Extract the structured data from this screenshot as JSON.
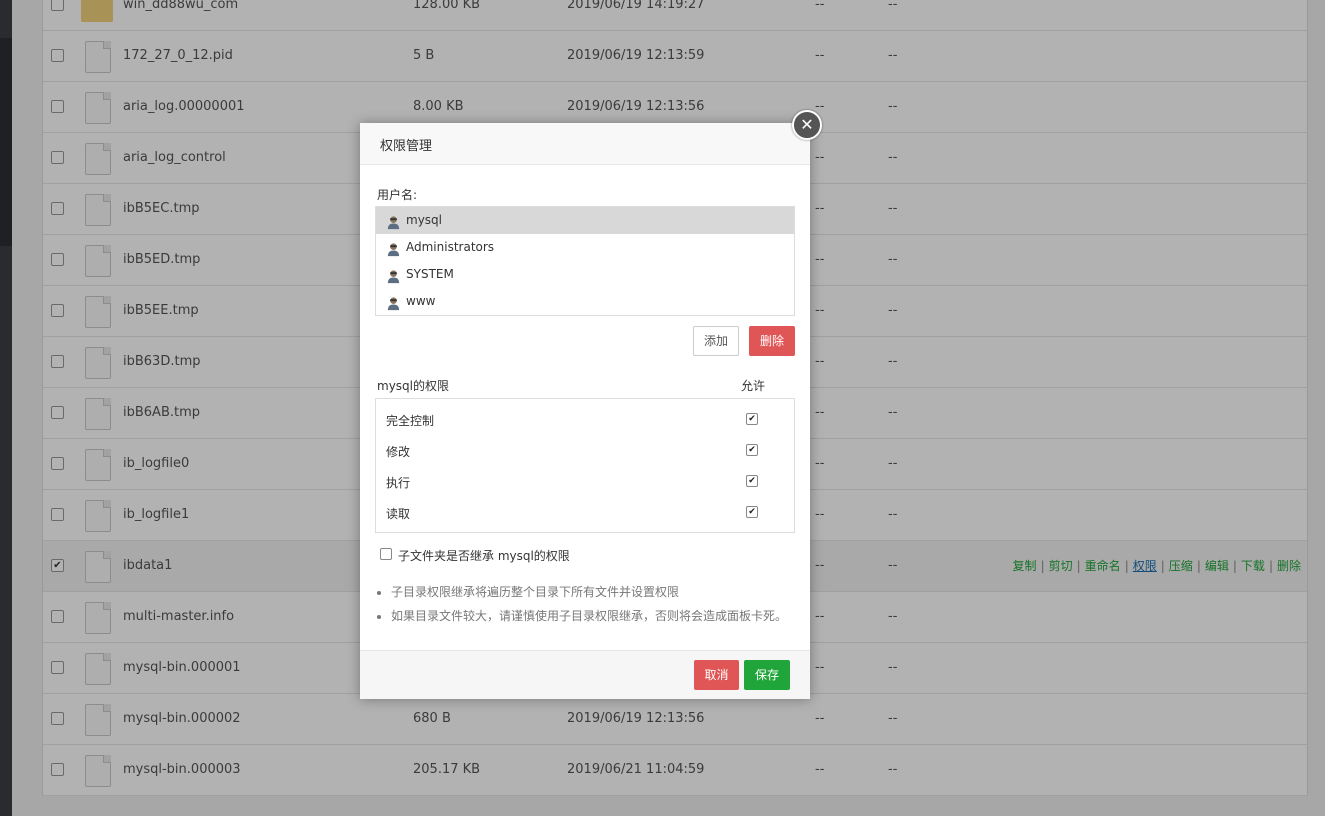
{
  "files": [
    {
      "name": "win_dd88wu_com",
      "size": "128.00 KB",
      "date": "2019/06/19 14:19:27",
      "owner": "--",
      "perm": "--",
      "type": "folder",
      "checked": false
    },
    {
      "name": "172_27_0_12.pid",
      "size": "5 B",
      "date": "2019/06/19 12:13:59",
      "owner": "--",
      "perm": "--",
      "type": "file",
      "checked": false
    },
    {
      "name": "aria_log.00000001",
      "size": "8.00 KB",
      "date": "2019/06/19 12:13:56",
      "owner": "--",
      "perm": "--",
      "type": "file",
      "checked": false
    },
    {
      "name": "aria_log_control",
      "size": "",
      "date": "",
      "owner": "--",
      "perm": "--",
      "type": "file",
      "checked": false
    },
    {
      "name": "ibB5EC.tmp",
      "size": "",
      "date": "",
      "owner": "--",
      "perm": "--",
      "type": "file",
      "checked": false
    },
    {
      "name": "ibB5ED.tmp",
      "size": "",
      "date": "",
      "owner": "--",
      "perm": "--",
      "type": "file",
      "checked": false
    },
    {
      "name": "ibB5EE.tmp",
      "size": "",
      "date": "",
      "owner": "--",
      "perm": "--",
      "type": "file",
      "checked": false
    },
    {
      "name": "ibB63D.tmp",
      "size": "",
      "date": "",
      "owner": "--",
      "perm": "--",
      "type": "file",
      "checked": false
    },
    {
      "name": "ibB6AB.tmp",
      "size": "",
      "date": "",
      "owner": "--",
      "perm": "--",
      "type": "file",
      "checked": false
    },
    {
      "name": "ib_logfile0",
      "size": "",
      "date": "",
      "owner": "--",
      "perm": "--",
      "type": "file",
      "checked": false
    },
    {
      "name": "ib_logfile1",
      "size": "",
      "date": "",
      "owner": "--",
      "perm": "--",
      "type": "file",
      "checked": false
    },
    {
      "name": "ibdata1",
      "size": "",
      "date": "",
      "owner": "--",
      "perm": "--",
      "type": "file",
      "checked": true
    },
    {
      "name": "multi-master.info",
      "size": "",
      "date": "",
      "owner": "--",
      "perm": "--",
      "type": "file",
      "checked": false
    },
    {
      "name": "mysql-bin.000001",
      "size": "",
      "date": "",
      "owner": "--",
      "perm": "--",
      "type": "file",
      "checked": false
    },
    {
      "name": "mysql-bin.000002",
      "size": "680 B",
      "date": "2019/06/19 12:13:56",
      "owner": "--",
      "perm": "--",
      "type": "file",
      "checked": false
    },
    {
      "name": "mysql-bin.000003",
      "size": "205.17 KB",
      "date": "2019/06/21 11:04:59",
      "owner": "--",
      "perm": "--",
      "type": "file",
      "checked": false
    }
  ],
  "row_actions": [
    "复制",
    "剪切",
    "重命名",
    "权限",
    "压缩",
    "编辑",
    "下载",
    "删除"
  ],
  "row_actions_active": "权限",
  "row_actions_sep": "|",
  "dialog": {
    "title": "权限管理",
    "close_glyph": "✕",
    "user_label": "用户名:",
    "users": [
      {
        "name": "mysql",
        "selected": true
      },
      {
        "name": "Administrators",
        "selected": false
      },
      {
        "name": "SYSTEM",
        "selected": false
      },
      {
        "name": "www",
        "selected": false
      }
    ],
    "add_label": "添加",
    "delete_label": "删除",
    "perm_title": "mysql的权限",
    "perm_allow": "允许",
    "permissions": [
      {
        "name": "完全控制",
        "allowed": true
      },
      {
        "name": "修改",
        "allowed": true
      },
      {
        "name": "执行",
        "allowed": true
      },
      {
        "name": "读取",
        "allowed": true
      }
    ],
    "inherit_label": "子文件夹是否继承 mysql的权限",
    "inherit_checked": false,
    "notes": [
      "子目录权限继承将遍历整个目录下所有文件并设置权限",
      "如果目录文件较大，请谨慎使用子目录权限继承，否则将会造成面板卡死。"
    ],
    "cancel_label": "取消",
    "save_label": "保存"
  },
  "colors": {
    "accent_green": "#20a53a",
    "danger_red": "#e05555",
    "link_blue": "#1a6fb0"
  },
  "icons": {
    "file": "file-icon",
    "folder": "folder-icon",
    "user": "user-icon",
    "close": "close-icon",
    "check": "checkmark-icon"
  }
}
